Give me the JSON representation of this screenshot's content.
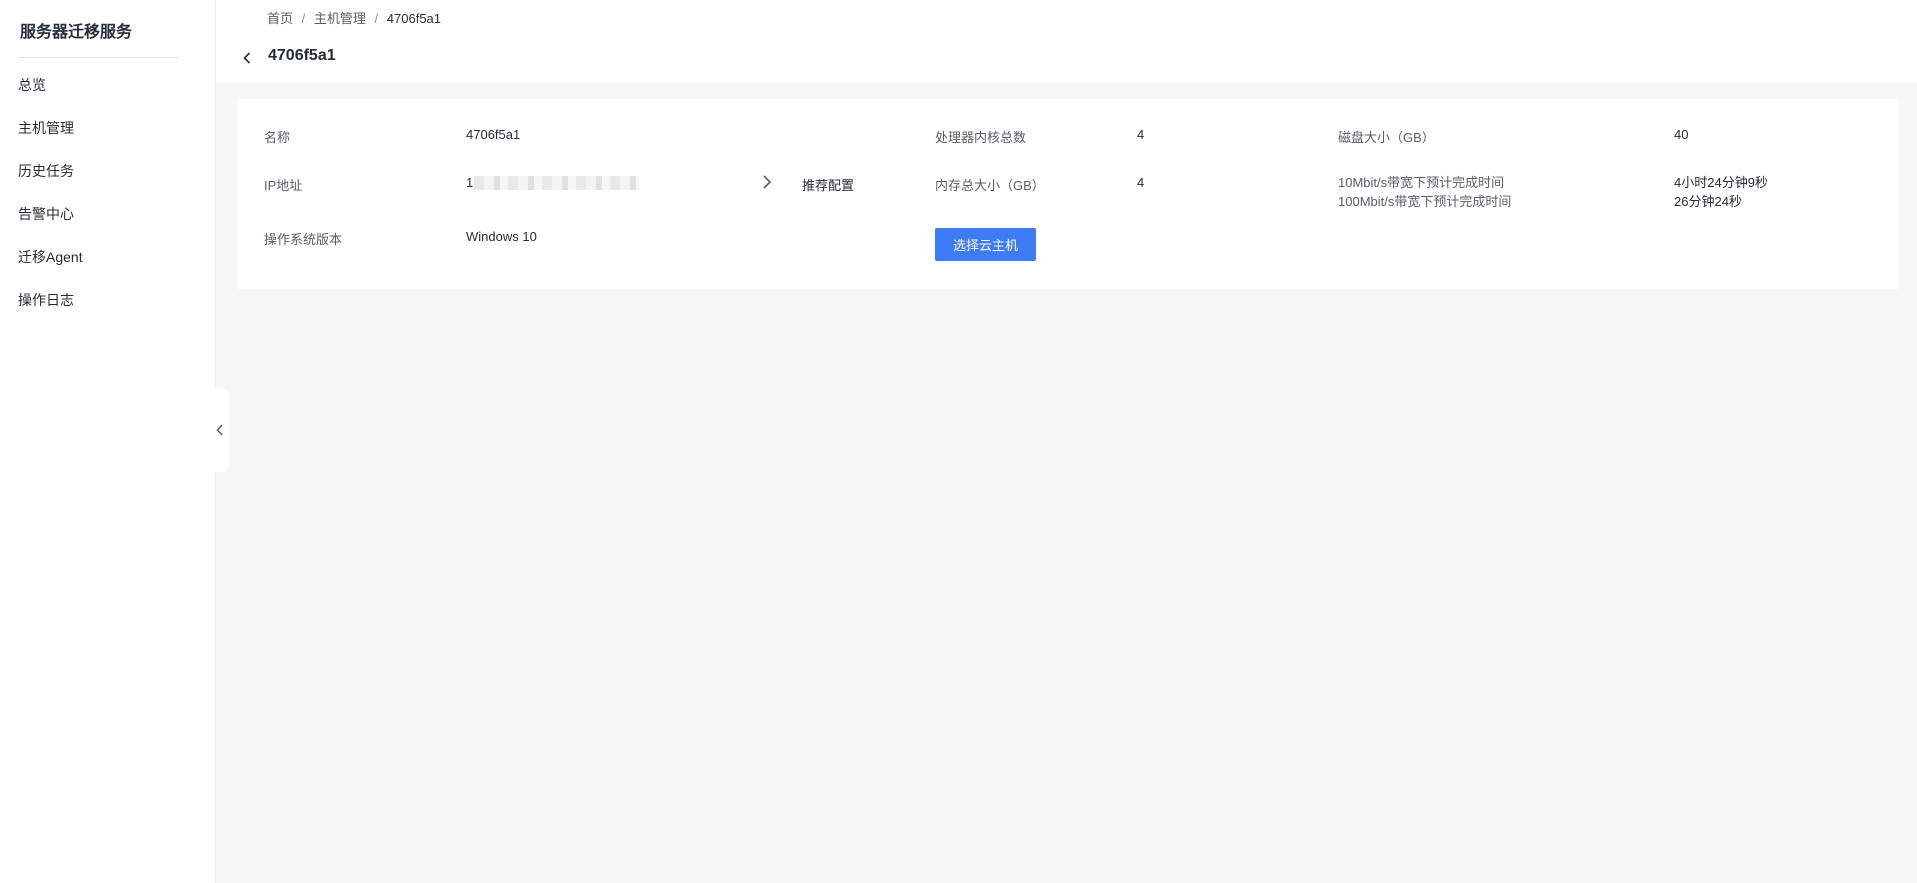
{
  "sidebar": {
    "title": "服务器迁移服务",
    "items": [
      {
        "label": "总览"
      },
      {
        "label": "主机管理"
      },
      {
        "label": "历史任务"
      },
      {
        "label": "告警中心"
      },
      {
        "label": "迁移Agent"
      },
      {
        "label": "操作日志"
      }
    ]
  },
  "header": {
    "breadcrumb": [
      "首页",
      "主机管理",
      "4706f5a1"
    ],
    "separator": "/",
    "title": "4706f5a1"
  },
  "details": {
    "name_label": "名称",
    "name_value": "4706f5a1",
    "ip_label": "IP地址",
    "ip_value": "1",
    "os_label": "操作系统版本",
    "os_value": "Windows 10",
    "recommend_label": "推荐配置",
    "cpu_label": "处理器内核总数",
    "cpu_value": "4",
    "memory_label": "内存总大小（GB）",
    "memory_value": "4",
    "select_button": "选择云主机",
    "disk_label": "磁盘大小（GB）",
    "disk_value": "40",
    "time_10m_label": "10Mbit/s带宽下预计完成时间",
    "time_100m_label": "100Mbit/s带宽下预计完成时间",
    "time_10m_value": "4小时24分钟9秒",
    "time_100m_value": "26分钟24秒"
  },
  "colors": {
    "accent": "#3e7cf5",
    "background": "#f5f6f8"
  },
  "icons": {
    "back": "chevron-left-icon",
    "collapse": "chevron-left-icon",
    "expand_recommend": "chevron-right-icon"
  }
}
